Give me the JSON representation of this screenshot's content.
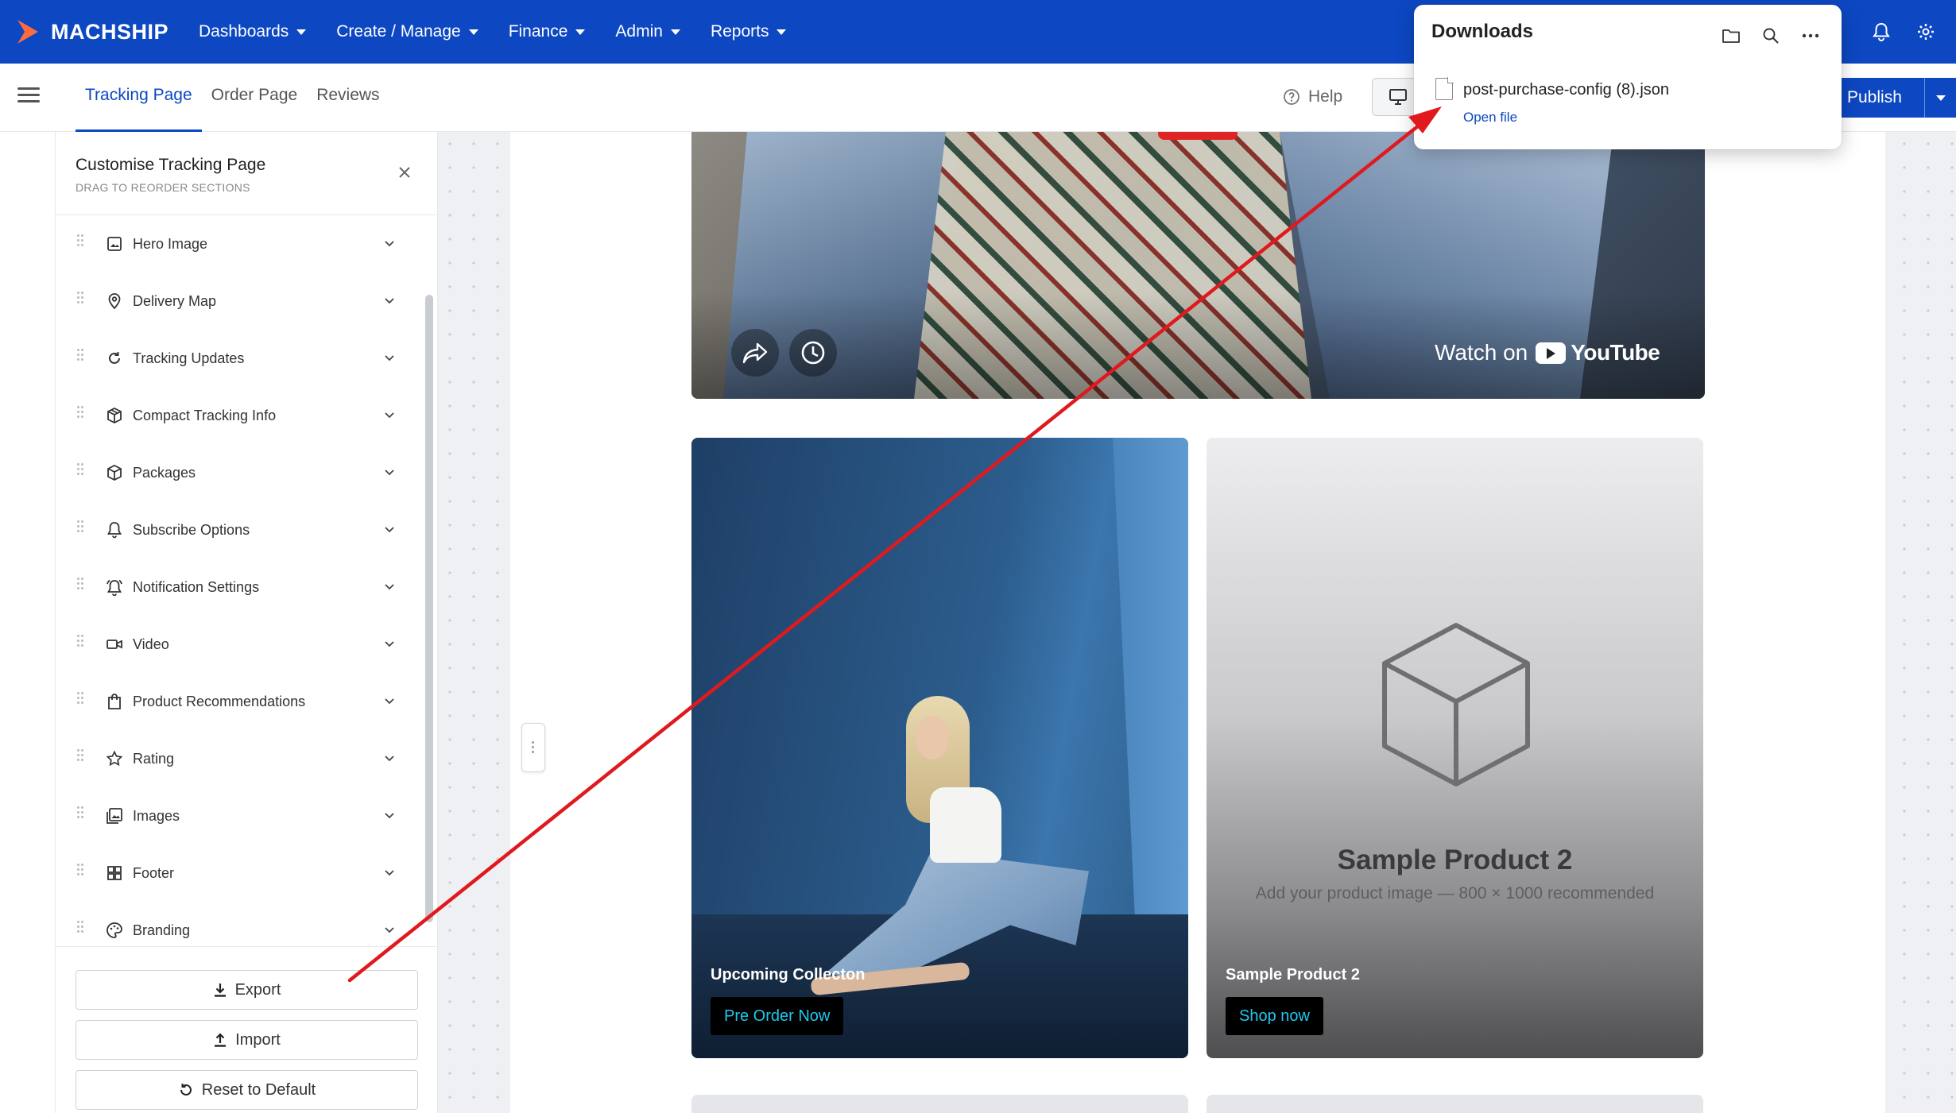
{
  "app": {
    "brand": "MACHSHIP",
    "nav": [
      "Dashboards",
      "Create / Manage",
      "Finance",
      "Admin",
      "Reports"
    ]
  },
  "tabs": [
    "Tracking Page",
    "Order Page",
    "Reviews"
  ],
  "toolbar": {
    "help": "Help",
    "publish": "Publish"
  },
  "panel": {
    "title": "Customise Tracking Page",
    "subtitle": "DRAG TO REORDER SECTIONS",
    "sections": [
      {
        "label": "Hero Image",
        "icon": "image-icon"
      },
      {
        "label": "Delivery Map",
        "icon": "map-pin-icon"
      },
      {
        "label": "Tracking Updates",
        "icon": "refresh-icon"
      },
      {
        "label": "Compact Tracking Info",
        "icon": "package-icon"
      },
      {
        "label": "Packages",
        "icon": "box-icon"
      },
      {
        "label": "Subscribe Options",
        "icon": "bell-icon"
      },
      {
        "label": "Notification Settings",
        "icon": "bell-ring-icon"
      },
      {
        "label": "Video",
        "icon": "video-icon"
      },
      {
        "label": "Product Recommendations",
        "icon": "shopping-bag-icon"
      },
      {
        "label": "Rating",
        "icon": "star-icon"
      },
      {
        "label": "Images",
        "icon": "images-icon"
      },
      {
        "label": "Footer",
        "icon": "layout-grid-icon"
      },
      {
        "label": "Branding",
        "icon": "palette-icon"
      }
    ],
    "buttons": {
      "export": "Export",
      "import": "Import",
      "reset": "Reset to Default"
    }
  },
  "preview": {
    "video": {
      "watch_on": "Watch on",
      "youtube": "YouTube"
    },
    "cards": [
      {
        "caption": "Upcoming Collecton",
        "button": "Pre Order Now"
      },
      {
        "title": "Sample Product 2",
        "subtitle": "Add your product image — 800 × 1000 recommended",
        "caption": "Sample Product 2",
        "button": "Shop now"
      }
    ]
  },
  "downloads": {
    "title": "Downloads",
    "file_name": "post-purchase-config (8).json",
    "open_file": "Open file"
  },
  "colors": {
    "brand_blue": "#0d47c2",
    "annotation_red": "#e0191f",
    "card_button_text": "#1ec8f0"
  }
}
